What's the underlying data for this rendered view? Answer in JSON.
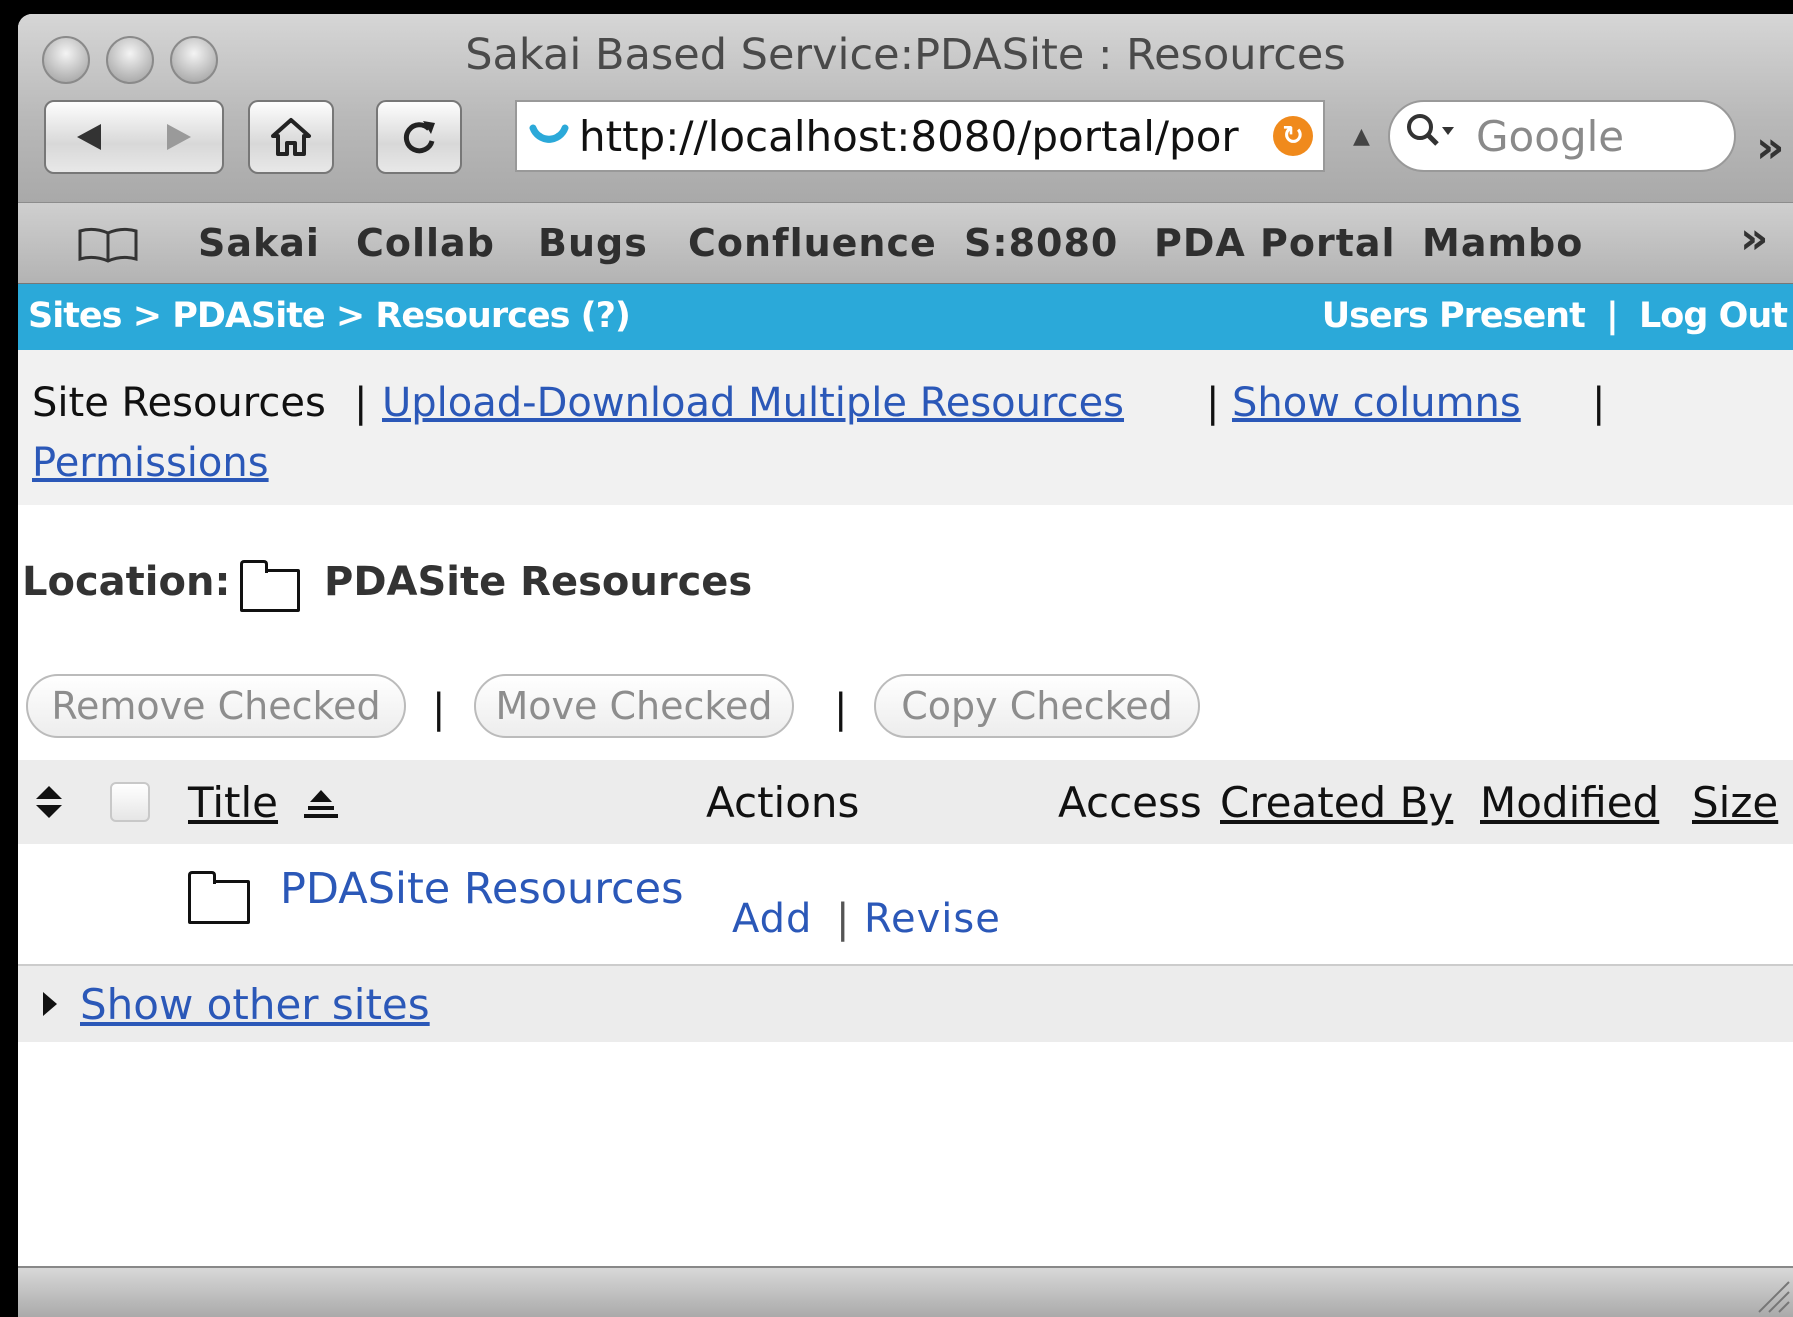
{
  "window": {
    "title": "Sakai Based Service:PDASite : Resources"
  },
  "toolbar": {
    "url": "http://localhost:8080/portal/por",
    "search_placeholder": "Google",
    "overflow": "»"
  },
  "bookmarks": {
    "items": [
      "Sakai",
      "Collab",
      "Bugs",
      "Confluence",
      "S:8080",
      "PDA Portal",
      "Mambo"
    ],
    "overflow": "»"
  },
  "portal": {
    "breadcrumb": "Sites > PDASite > Resources  (?)",
    "users_present": "Users Present",
    "divider": "|",
    "log_out": "Log Out"
  },
  "tool_menu": {
    "current": "Site Resources",
    "divider": "|",
    "upload_download": "Upload-Download Multiple Resources",
    "show_columns": "Show columns",
    "permissions": "Permissions"
  },
  "location": {
    "label": "Location:",
    "name": "PDASite Resources"
  },
  "actions": {
    "remove": "Remove Checked",
    "move": "Move Checked",
    "copy": "Copy Checked",
    "divider": "|"
  },
  "table": {
    "headers": {
      "title": "Title",
      "actions": "Actions",
      "access": "Access",
      "created_by": "Created By",
      "modified": "Modified",
      "size": "Size"
    },
    "rows": [
      {
        "title": "PDASite Resources",
        "add": "Add",
        "divider": "|",
        "revise": "Revise"
      }
    ]
  },
  "other_sites": {
    "label": "Show other sites"
  }
}
